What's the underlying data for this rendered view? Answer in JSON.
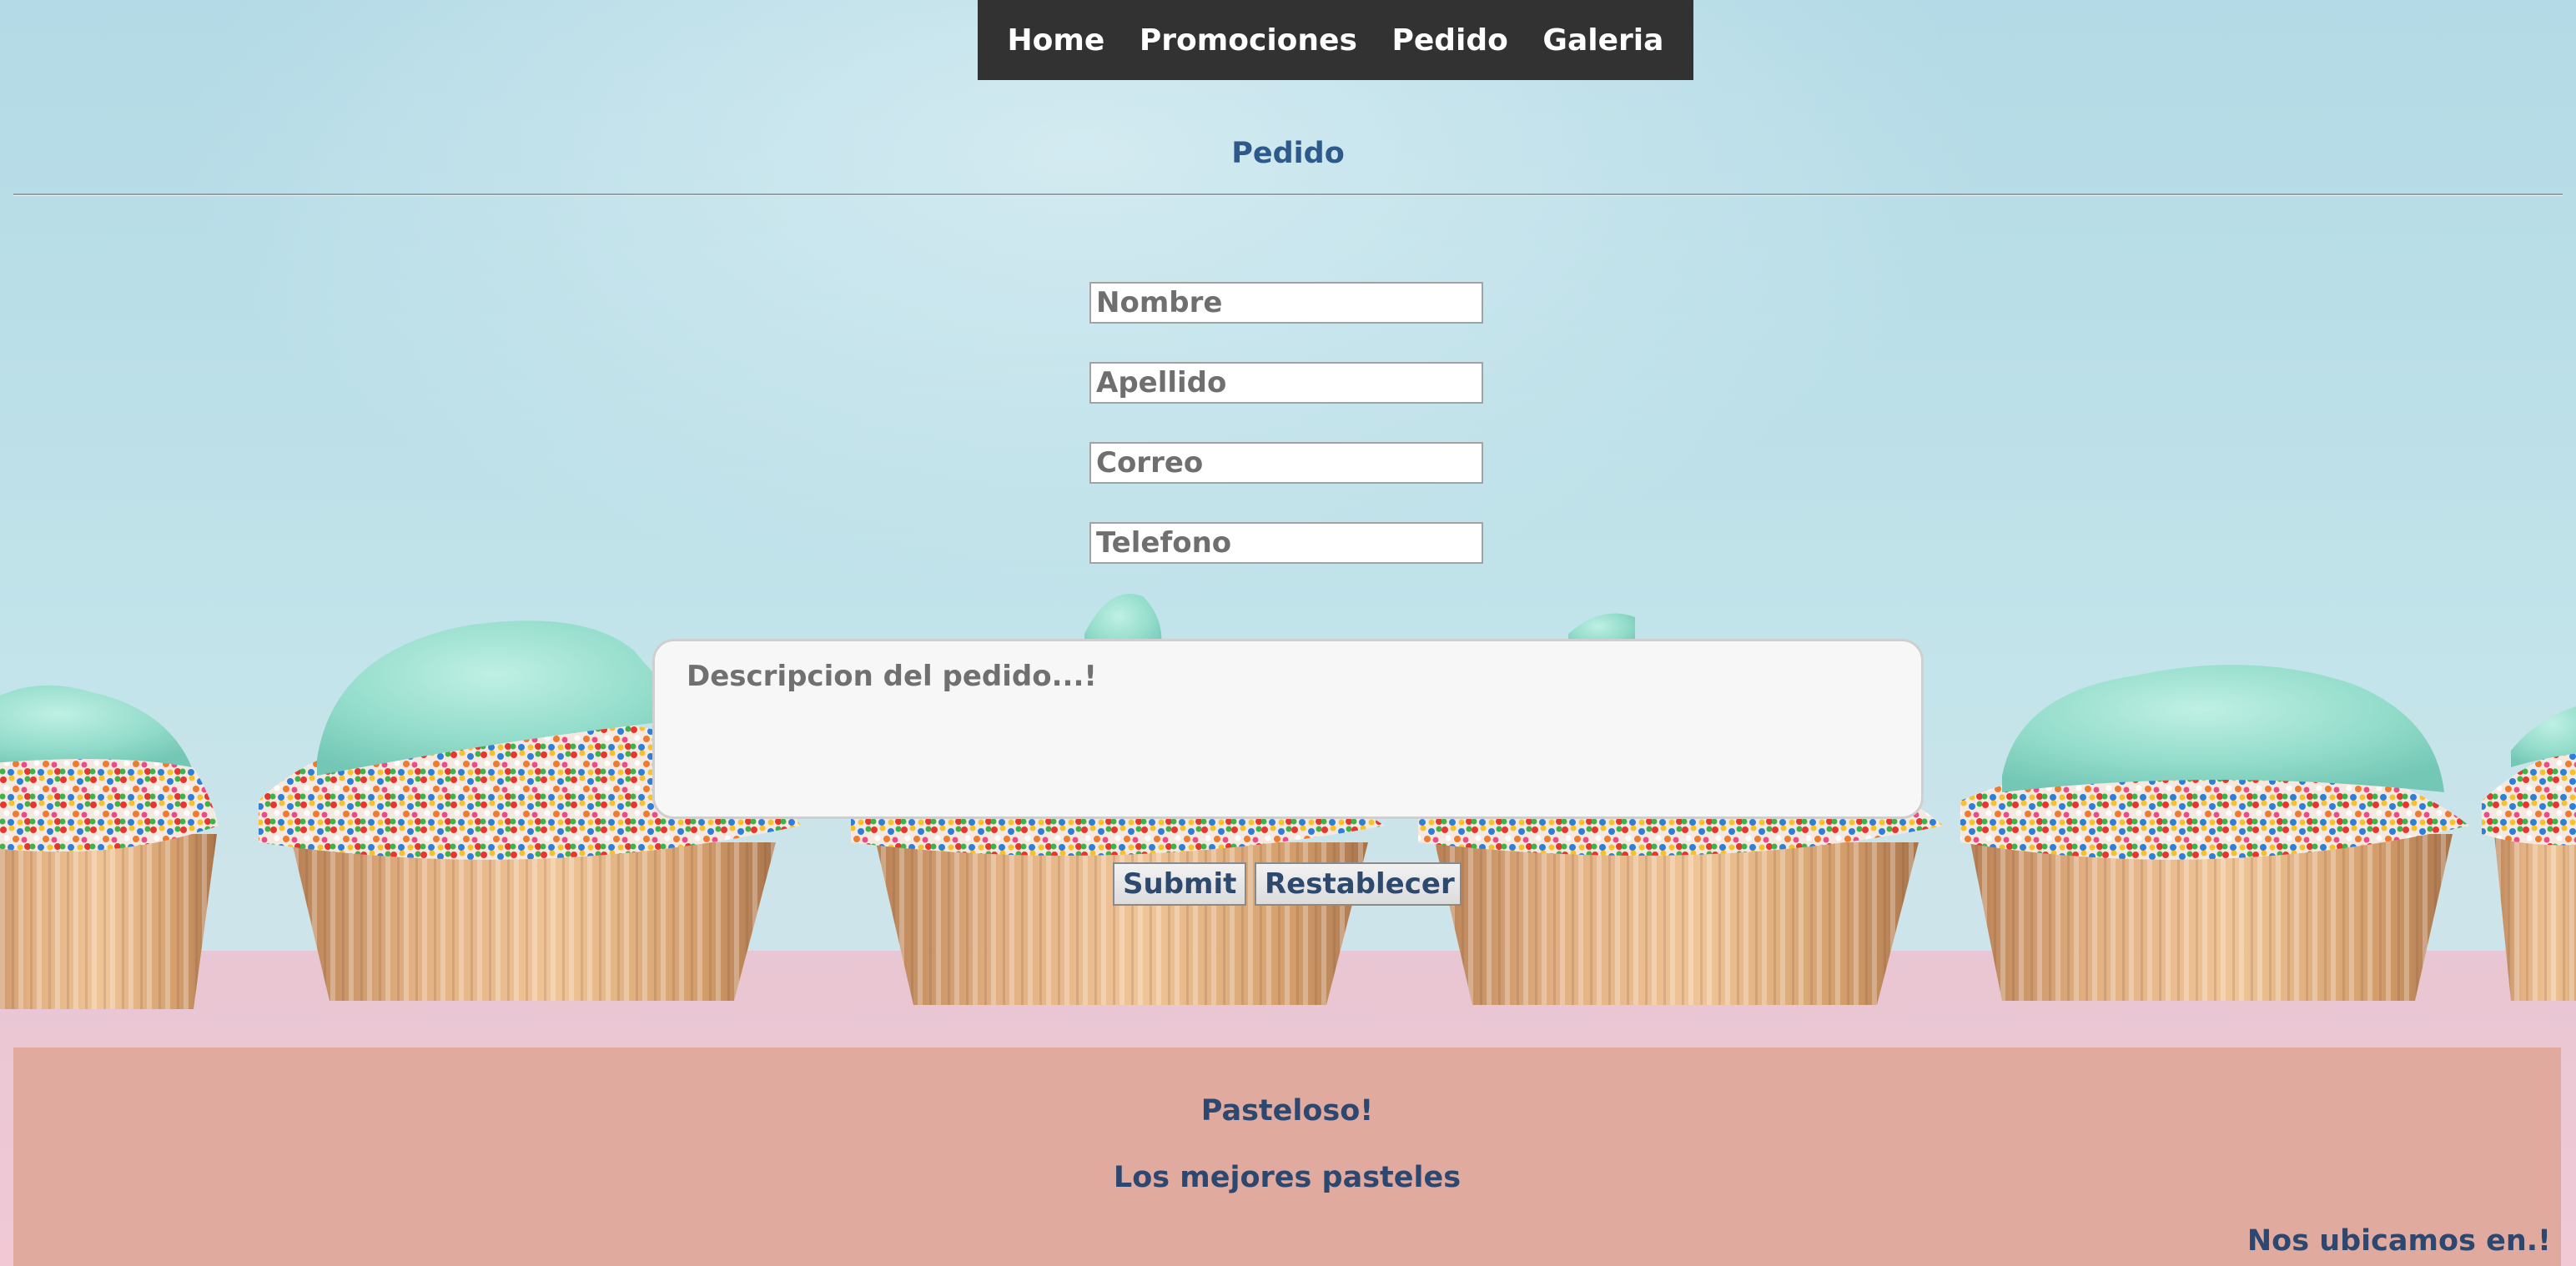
{
  "nav": {
    "items": [
      {
        "label": "Home"
      },
      {
        "label": "Promociones"
      },
      {
        "label": "Pedido"
      },
      {
        "label": "Galeria"
      }
    ]
  },
  "page": {
    "title": "Pedido"
  },
  "form": {
    "nombre_placeholder": "Nombre",
    "apellido_placeholder": "Apellido",
    "correo_placeholder": "Correo",
    "telefono_placeholder": "Telefono",
    "descripcion_placeholder": "Descripcion del pedido...!",
    "submit_label": "Submit",
    "reset_label": "Restablecer"
  },
  "footer": {
    "brand": "Pasteloso!",
    "slogan": "Los mejores pasteles",
    "location": "Nos ubicamos en.!"
  },
  "colors": {
    "nav_background": "#323232",
    "title_text": "#2d5a8a",
    "footer_background": "#e0aa9e",
    "footer_text": "#2c4770"
  }
}
